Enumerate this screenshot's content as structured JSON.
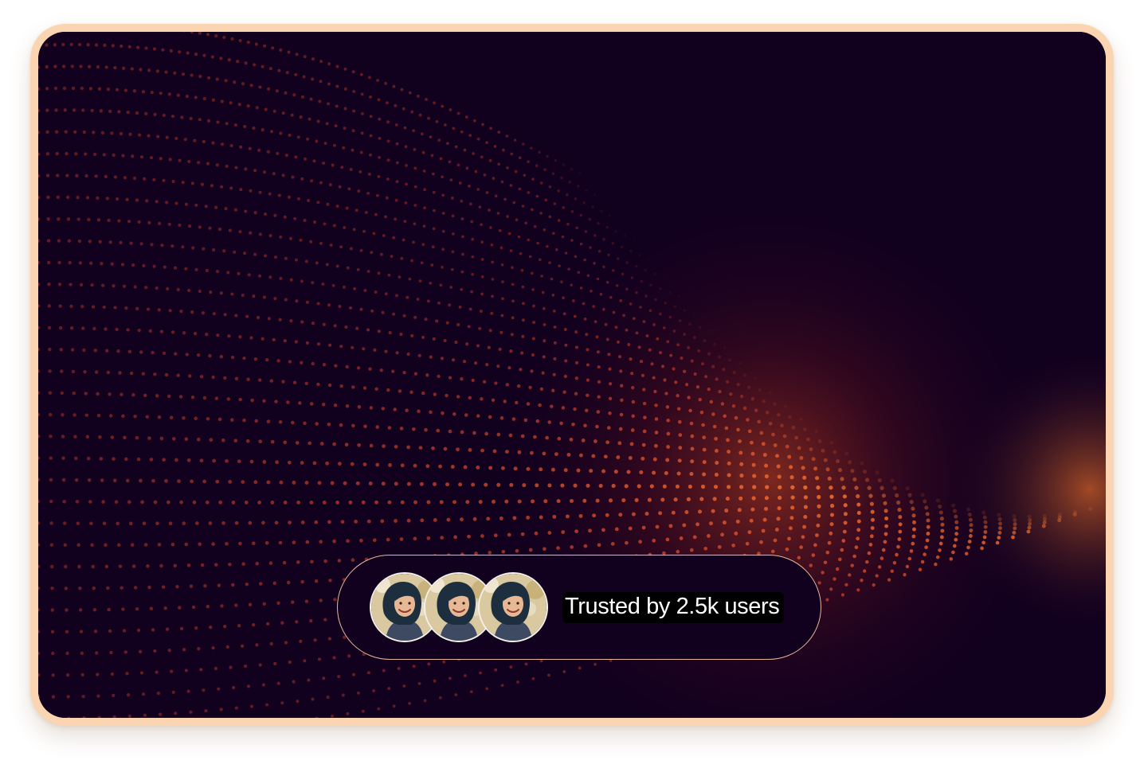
{
  "hero": {
    "background_colors": {
      "base": "#12001f",
      "dot": "#d2452a",
      "glow": "#ff5a1f",
      "frame": "#fbd5b1",
      "pill_border": "#e8b79a"
    }
  },
  "trust_badge": {
    "text": "Trusted by 2.5k users",
    "avatars": [
      {
        "name": "user-avatar"
      },
      {
        "name": "user-avatar"
      },
      {
        "name": "user-avatar"
      }
    ]
  }
}
